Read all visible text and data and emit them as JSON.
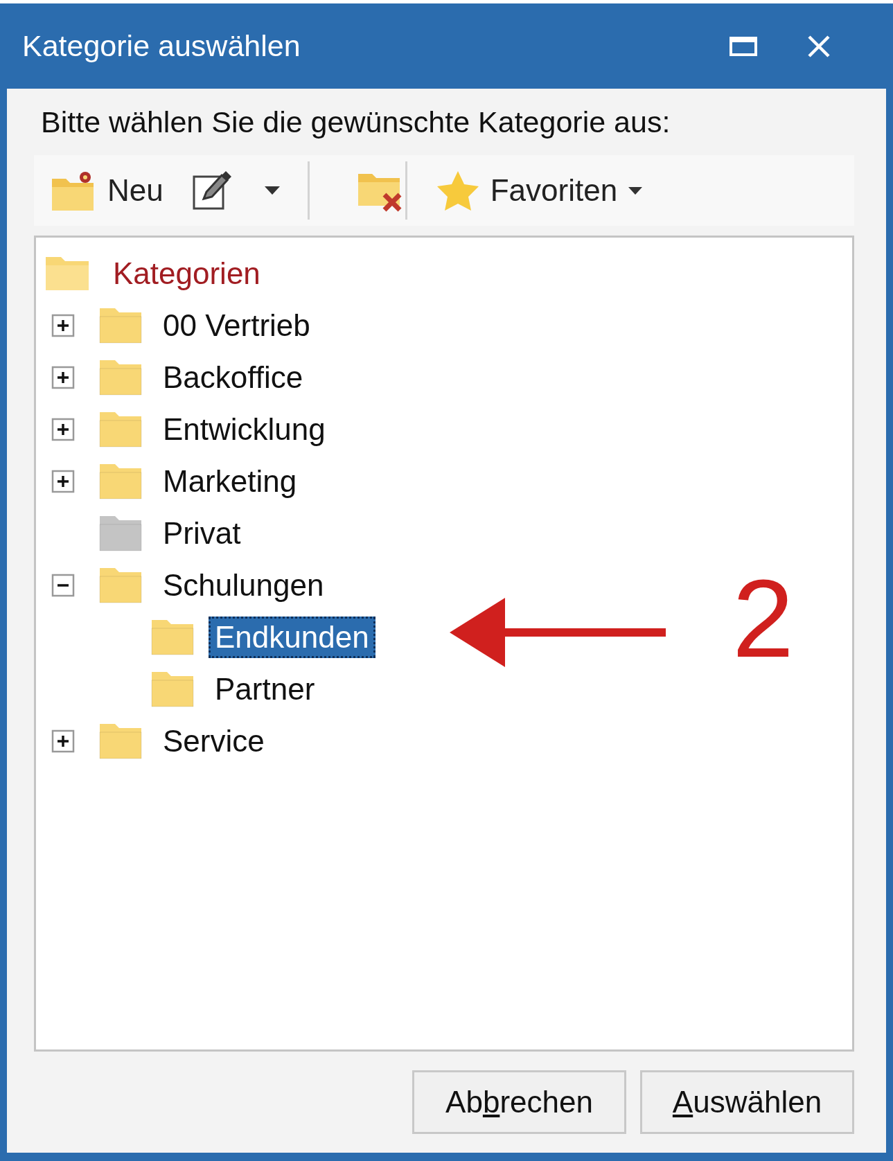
{
  "window": {
    "title": "Kategorie auswählen"
  },
  "instruction": "Bitte wählen Sie die gewünschte Kategorie aus:",
  "toolbar": {
    "new_label": "Neu",
    "favorites_label": "Favoriten"
  },
  "tree": {
    "label": "Kategorien",
    "selected": false,
    "children": [
      {
        "label": "00 Vertrieb",
        "kind": "folder",
        "expanded": false,
        "selected": false
      },
      {
        "label": "Backoffice",
        "kind": "folder",
        "expanded": false,
        "selected": false
      },
      {
        "label": "Entwicklung",
        "kind": "folder",
        "expanded": false,
        "selected": false
      },
      {
        "label": "Marketing",
        "kind": "folder",
        "expanded": false,
        "selected": false
      },
      {
        "label": "Privat",
        "kind": "private",
        "selected": false
      },
      {
        "label": "Schulungen",
        "kind": "folder",
        "expanded": true,
        "selected": false,
        "children": [
          {
            "label": "Endkunden",
            "kind": "folder",
            "selected": true
          },
          {
            "label": "Partner",
            "kind": "folder",
            "selected": false
          }
        ]
      },
      {
        "label": "Service",
        "kind": "folder",
        "expanded": false,
        "selected": false
      }
    ]
  },
  "annotation": {
    "label": "2"
  },
  "buttons": [
    {
      "before": "Ab",
      "access_key": "b",
      "after": "rechen"
    },
    {
      "access_key": "A",
      "after": "uswählen"
    }
  ]
}
